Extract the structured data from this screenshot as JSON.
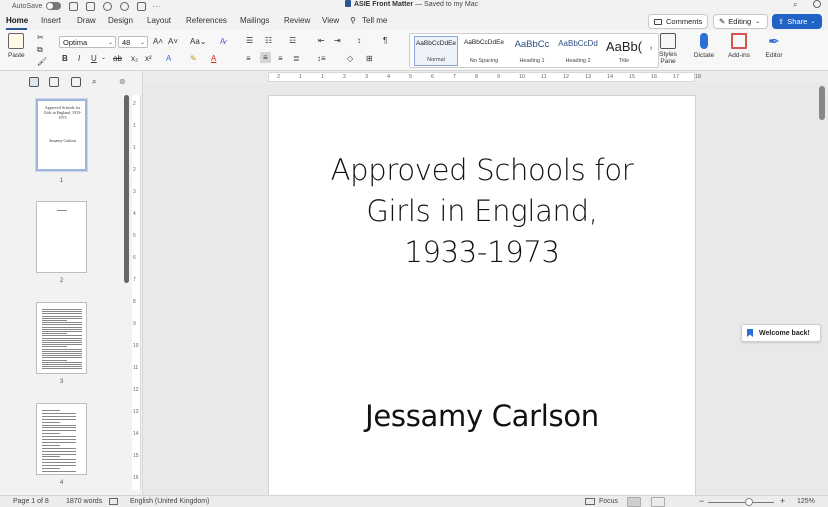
{
  "titlebar": {
    "autosave_label": "AutoSave",
    "doc_name": "ASIE Front Matter",
    "saved_status": "— Saved to my Mac"
  },
  "tabs": [
    "Home",
    "Insert",
    "Draw",
    "Design",
    "Layout",
    "References",
    "Mailings",
    "Review",
    "View",
    "Tell me"
  ],
  "actions": {
    "comments": "Comments",
    "editing": "Editing",
    "share": "Share"
  },
  "ribbon": {
    "paste_label": "Paste",
    "font_name": "Optima",
    "font_size": "48",
    "styles": [
      {
        "preview": "AaBbCcDdEe",
        "name": "Normal"
      },
      {
        "preview": "AaBbCcDdEe",
        "name": "No Spacing"
      },
      {
        "preview": "AaBbCc",
        "name": "Heading 1"
      },
      {
        "preview": "AaBbCcDd",
        "name": "Heading 2"
      },
      {
        "preview": "AaBb(",
        "name": "Title"
      }
    ],
    "styles_pane_label": "Styles Pane",
    "dictate_label": "Dictate",
    "addins_label": "Add-ins",
    "editor_label": "Editor"
  },
  "thumbnails": [
    {
      "page": "1",
      "title": "Approved Schools for Girls in England, 1933-1973",
      "author": "Jessamy Carlson"
    },
    {
      "page": "2"
    },
    {
      "page": "3"
    },
    {
      "page": "4"
    }
  ],
  "document": {
    "title_line1": "Approved Schools for",
    "title_line2": "Girls in England,",
    "title_line3": "1933-1973",
    "author": "Jessamy Carlson"
  },
  "welcome": "Welcome back!",
  "status": {
    "page": "Page 1 of 8",
    "words": "1870 words",
    "language": "English (United Kingdom)",
    "focus": "Focus",
    "zoom": "125%"
  },
  "ruler_h": [
    "2",
    "1",
    "1",
    "2",
    "3",
    "4",
    "5",
    "6",
    "7",
    "8",
    "9",
    "10",
    "11",
    "12",
    "13",
    "14",
    "15",
    "16",
    "17",
    "18"
  ],
  "ruler_v": [
    "2",
    "1",
    "1",
    "2",
    "3",
    "4",
    "5",
    "6",
    "7",
    "8",
    "9",
    "10",
    "11",
    "12",
    "13",
    "14",
    "15",
    "16"
  ],
  "colors": {
    "accent": "#2b579a",
    "share": "#2062c6",
    "font_color": "#e02020",
    "highlight": "#f5e000"
  }
}
